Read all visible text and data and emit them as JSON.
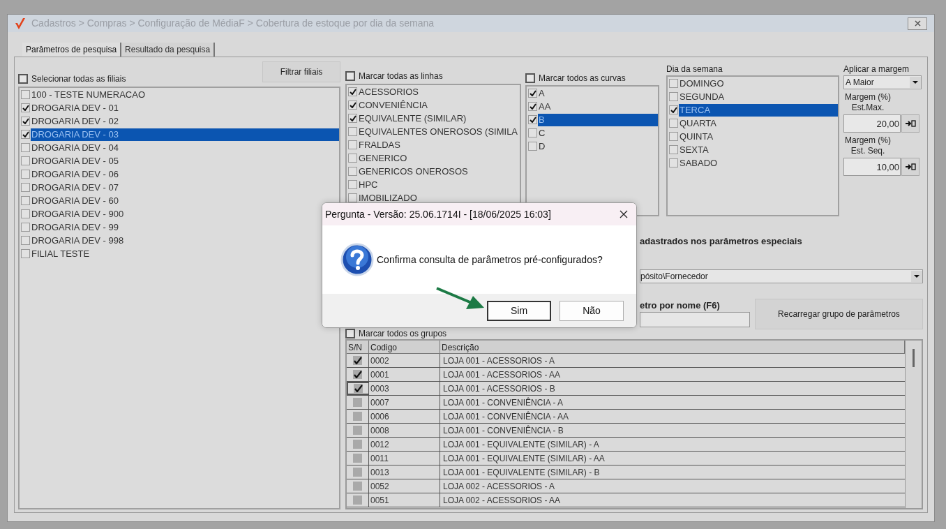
{
  "window": {
    "title": "Cadastros > Compras > Configuração de MédiaF > Cobertura de estoque por dia da semana"
  },
  "tabs": [
    {
      "label": "Parâmetros de pesquisa",
      "selected": true
    },
    {
      "label": "Resultado da pesquisa",
      "selected": false
    }
  ],
  "branches": {
    "select_all": {
      "label": "Selecionar todas as filiais",
      "checked": false
    },
    "filter_button": "Filtrar filiais",
    "items": [
      {
        "label": "100 - TESTE NUMERACAO",
        "checked": false,
        "selected": false
      },
      {
        "label": "DROGARIA DEV - 01",
        "checked": true,
        "selected": false
      },
      {
        "label": "DROGARIA DEV - 02",
        "checked": true,
        "selected": false
      },
      {
        "label": "DROGARIA DEV - 03",
        "checked": true,
        "selected": true
      },
      {
        "label": "DROGARIA DEV - 04",
        "checked": false,
        "selected": false
      },
      {
        "label": "DROGARIA DEV - 05",
        "checked": false,
        "selected": false
      },
      {
        "label": "DROGARIA DEV - 06",
        "checked": false,
        "selected": false
      },
      {
        "label": "DROGARIA DEV - 07",
        "checked": false,
        "selected": false
      },
      {
        "label": "DROGARIA DEV - 60",
        "checked": false,
        "selected": false
      },
      {
        "label": "DROGARIA DEV - 900",
        "checked": false,
        "selected": false
      },
      {
        "label": "DROGARIA DEV - 99",
        "checked": false,
        "selected": false
      },
      {
        "label": "DROGARIA DEV - 998",
        "checked": false,
        "selected": false
      },
      {
        "label": "FILIAL TESTE",
        "checked": false,
        "selected": false
      }
    ]
  },
  "lines": {
    "select_all": {
      "label": "Marcar todas as linhas",
      "checked": false
    },
    "items": [
      {
        "label": "ACESSORIOS",
        "checked": true,
        "selected": false
      },
      {
        "label": "CONVENIÊNCIA",
        "checked": true,
        "selected": false
      },
      {
        "label": "EQUIVALENTE (SIMILAR)",
        "checked": true,
        "selected": false
      },
      {
        "label": "EQUIVALENTES ONEROSOS (SIMILA",
        "checked": false,
        "selected": false
      },
      {
        "label": "FRALDAS",
        "checked": false,
        "selected": false
      },
      {
        "label": "GENERICO",
        "checked": false,
        "selected": false
      },
      {
        "label": "GENERICOS ONEROSOS",
        "checked": false,
        "selected": false
      },
      {
        "label": "HPC",
        "checked": false,
        "selected": false
      },
      {
        "label": "IMOBILIZADO",
        "checked": false,
        "selected": false
      }
    ]
  },
  "curves": {
    "select_all": {
      "label": "Marcar todos as curvas",
      "checked": false
    },
    "items": [
      {
        "label": "A",
        "checked": true,
        "selected": false
      },
      {
        "label": "AA",
        "checked": true,
        "selected": false
      },
      {
        "label": "B",
        "checked": true,
        "selected": true
      },
      {
        "label": "C",
        "checked": false,
        "selected": false
      },
      {
        "label": "D",
        "checked": false,
        "selected": false
      }
    ]
  },
  "weekdays": {
    "title": "Dia da semana",
    "items": [
      {
        "label": "DOMINGO",
        "checked": false,
        "selected": false
      },
      {
        "label": "SEGUNDA",
        "checked": false,
        "selected": false
      },
      {
        "label": "TERCA",
        "checked": true,
        "selected": true
      },
      {
        "label": "QUARTA",
        "checked": false,
        "selected": false
      },
      {
        "label": "QUINTA",
        "checked": false,
        "selected": false
      },
      {
        "label": "SEXTA",
        "checked": false,
        "selected": false
      },
      {
        "label": "SABADO",
        "checked": false,
        "selected": false
      }
    ]
  },
  "margin": {
    "apply_label": "Aplicar a margem",
    "apply_value": "A Maior",
    "fields": [
      {
        "label": "Margem (%)\nEst.Max.",
        "value": "20,00"
      },
      {
        "label": "Margem (%)\nEst. Seq.",
        "value": "10,00"
      }
    ]
  },
  "special": {
    "heading": "adastrados nos parâmetros especiais",
    "select_value": "pósito\\Fornecedor",
    "search_label": "etro por nome (F6)",
    "reload_button": "Recarregar grupo de parâmetros",
    "select_all": {
      "label": "Marcar todos os grupos",
      "checked": false
    }
  },
  "table": {
    "columns": [
      "S/N",
      "Codigo",
      "Descrição"
    ],
    "rows": [
      {
        "checked": true,
        "selected": false,
        "code": "0002",
        "description": "LOJA 001 - ACESSORIOS - A"
      },
      {
        "checked": true,
        "selected": false,
        "code": "0001",
        "description": "LOJA 001 - ACESSORIOS - AA"
      },
      {
        "checked": true,
        "selected": true,
        "code": "0003",
        "description": "LOJA 001 - ACESSORIOS - B"
      },
      {
        "checked": false,
        "selected": false,
        "code": "0007",
        "description": "LOJA 001 - CONVENIÊNCIA - A"
      },
      {
        "checked": false,
        "selected": false,
        "code": "0006",
        "description": "LOJA 001 - CONVENIÊNCIA - AA"
      },
      {
        "checked": false,
        "selected": false,
        "code": "0008",
        "description": "LOJA 001 - CONVENIÊNCIA - B"
      },
      {
        "checked": false,
        "selected": false,
        "code": "0012",
        "description": "LOJA 001 - EQUIVALENTE (SIMILAR) - A"
      },
      {
        "checked": false,
        "selected": false,
        "code": "0011",
        "description": "LOJA 001 - EQUIVALENTE (SIMILAR) - AA"
      },
      {
        "checked": false,
        "selected": false,
        "code": "0013",
        "description": "LOJA 001 - EQUIVALENTE (SIMILAR) - B"
      },
      {
        "checked": false,
        "selected": false,
        "code": "0052",
        "description": "LOJA 002 - ACESSORIOS - A"
      },
      {
        "checked": false,
        "selected": false,
        "code": "0051",
        "description": "LOJA 002 - ACESSORIOS - AA"
      }
    ]
  },
  "dialog": {
    "title": "Pergunta - Versão: 25.06.1714I - [18/06/2025 16:03]",
    "message": "Confirma consulta de parâmetros pré-configurados?",
    "buttons": [
      {
        "label": "Sim",
        "focused": true
      },
      {
        "label": "Não",
        "focused": false
      }
    ]
  }
}
